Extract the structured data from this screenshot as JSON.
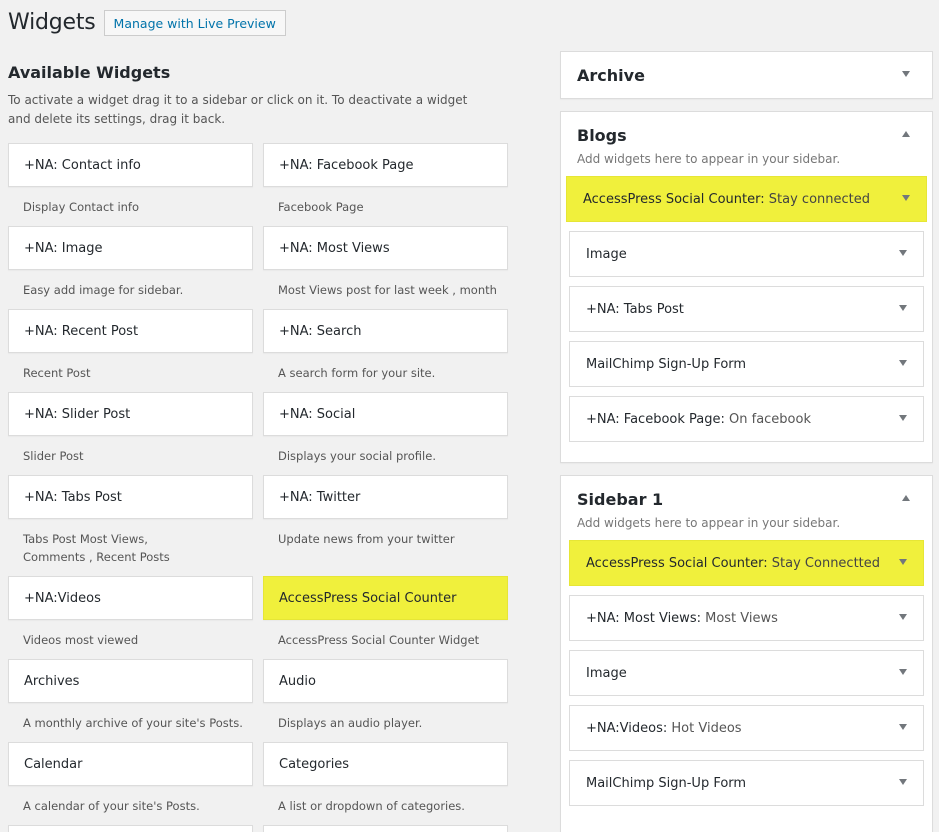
{
  "header": {
    "title": "Widgets",
    "live_preview_button": "Manage with Live Preview"
  },
  "available": {
    "title": "Available Widgets",
    "description": "To activate a widget drag it to a sidebar or click on it. To deactivate a widget and delete its settings, drag it back."
  },
  "widgets": [
    {
      "name": "+NA: Contact info",
      "desc": "Display Contact info"
    },
    {
      "name": "+NA: Facebook Page",
      "desc": "Facebook Page"
    },
    {
      "name": "+NA: Image",
      "desc": "Easy add image for sidebar."
    },
    {
      "name": "+NA: Most Views",
      "desc": "Most Views post for last week , month"
    },
    {
      "name": "+NA: Recent Post",
      "desc": "Recent Post"
    },
    {
      "name": "+NA: Search",
      "desc": "A search form for your site."
    },
    {
      "name": "+NA: Slider Post",
      "desc": "Slider Post"
    },
    {
      "name": "+NA: Social",
      "desc": "Displays your social profile."
    },
    {
      "name": "+NA: Tabs Post",
      "desc": "Tabs Post Most Views, Comments , Recent Posts"
    },
    {
      "name": "+NA: Twitter",
      "desc": "Update news from your twitter"
    },
    {
      "name": "+NA:Videos",
      "desc": "Videos most viewed"
    },
    {
      "name": "AccessPress Social Counter",
      "desc": "AccessPress Social Counter Widget"
    },
    {
      "name": "Archives",
      "desc": "A monthly archive of your site's Posts."
    },
    {
      "name": "Audio",
      "desc": "Displays an audio player."
    },
    {
      "name": "Calendar",
      "desc": "A calendar of your site's Posts."
    },
    {
      "name": "Categories",
      "desc": "A list or dropdown of categories."
    }
  ],
  "sidebars": {
    "archive": {
      "title": "Archive"
    },
    "blogs": {
      "title": "Blogs",
      "description": "Add widgets here to appear in your sidebar.",
      "items": [
        {
          "name": "AccessPress Social Counter:",
          "sub": "Stay connected"
        },
        {
          "name": "Image",
          "sub": ""
        },
        {
          "name": "+NA: Tabs Post",
          "sub": ""
        },
        {
          "name": "MailChimp Sign-Up Form",
          "sub": ""
        },
        {
          "name": "+NA: Facebook Page:",
          "sub": "On facebook"
        }
      ]
    },
    "sidebar1": {
      "title": "Sidebar 1",
      "description": "Add widgets here to appear in your sidebar.",
      "items": [
        {
          "name": "AccessPress Social Counter:",
          "sub": "Stay Connectted"
        },
        {
          "name": "+NA: Most Views:",
          "sub": "Most Views"
        },
        {
          "name": "Image",
          "sub": ""
        },
        {
          "name": "+NA:Videos:",
          "sub": "Hot Videos"
        },
        {
          "name": "MailChimp Sign-Up Form",
          "sub": ""
        }
      ]
    }
  },
  "colors": {
    "highlight": "#f0f03c",
    "link": "#0073aa",
    "background": "#f1f1f1"
  },
  "icons": {
    "toggle_collapsed": "arrow-down-icon",
    "toggle_expanded": "arrow-up-icon"
  }
}
